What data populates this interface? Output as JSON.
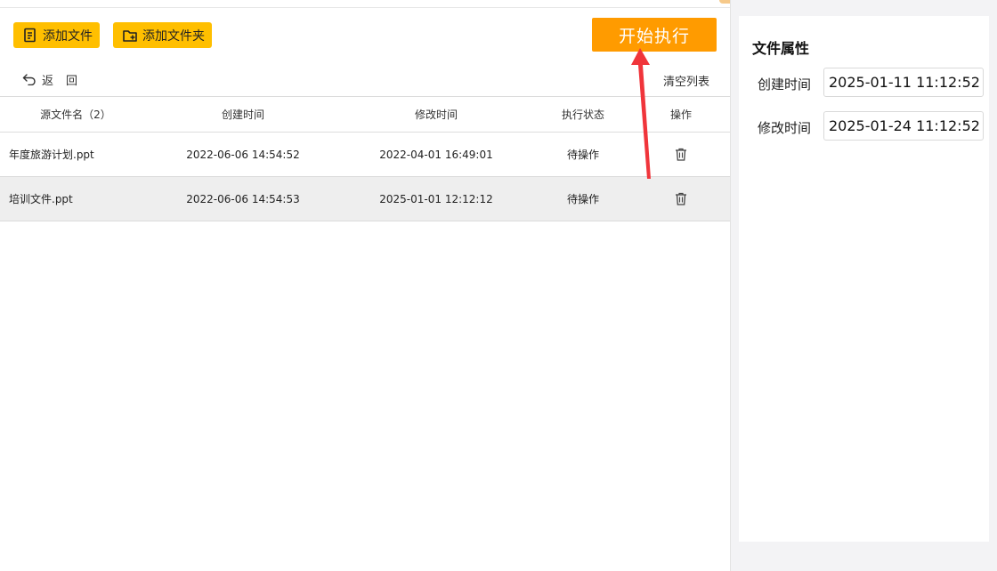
{
  "toolbar": {
    "add_file_label": "添加文件",
    "add_folder_label": "添加文件夹",
    "start_label": "开始执行",
    "back_label": "返回",
    "clear_label": "清空列表"
  },
  "table": {
    "headers": {
      "name": "源文件名（2）",
      "created": "创建时间",
      "modified": "修改时间",
      "status": "执行状态",
      "action": "操作"
    },
    "rows": [
      {
        "name": "年度旅游计划.ppt",
        "created": "2022-06-06 14:54:52",
        "modified": "2022-04-01 16:49:01",
        "status": "待操作",
        "action_icon": "trash-icon"
      },
      {
        "name": "培训文件.ppt",
        "created": "2022-06-06 14:54:53",
        "modified": "2025-01-01 12:12:12",
        "status": "待操作",
        "action_icon": "trash-icon"
      }
    ]
  },
  "properties": {
    "title": "文件属性",
    "created_label": "创建时间",
    "created_value": "2025-01-11 11:12:52",
    "modified_label": "修改时间",
    "modified_value": "2025-01-24 11:12:52"
  },
  "colors": {
    "yellow_button": "#ffbf00",
    "start_button": "#ff9b00",
    "annotation_arrow": "#f0353b",
    "selected_row": "#eeeeee"
  }
}
